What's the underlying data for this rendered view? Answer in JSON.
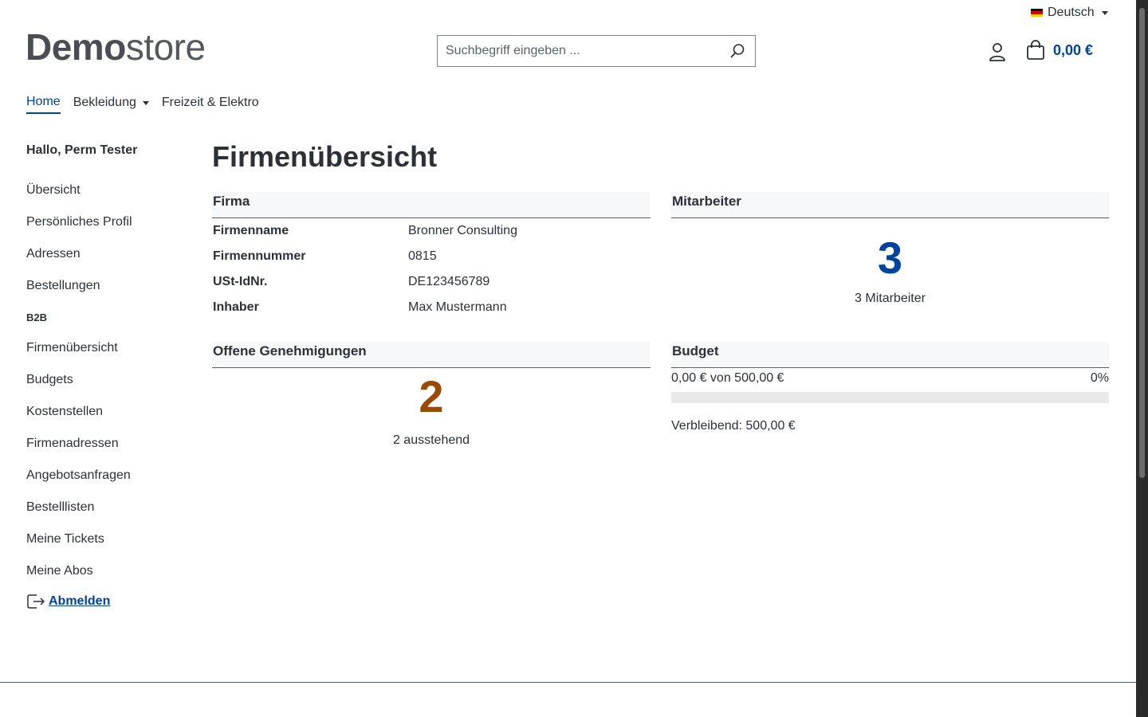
{
  "header": {
    "language": "Deutsch",
    "logo_bold": "Demo",
    "logo_light": "store",
    "search_placeholder": "Suchbegriff eingeben ...",
    "cart_total": "0,00 €"
  },
  "nav": {
    "items": [
      {
        "label": "Home",
        "active": true
      },
      {
        "label": "Bekleidung",
        "dropdown": true
      },
      {
        "label": "Freizeit & Elektro"
      }
    ]
  },
  "sidebar": {
    "greeting": "Hallo, Perm Tester",
    "items_top": [
      "Übersicht",
      "Persönliches Profil",
      "Adressen",
      "Bestellungen"
    ],
    "b2b_heading": "B2B",
    "items_b2b": [
      "Firmenübersicht",
      "Budgets",
      "Kostenstellen",
      "Firmenadressen",
      "Angebotsanfragen",
      "Bestelllisten",
      "Meine Tickets",
      "Meine Abos"
    ],
    "logout": "Abmelden"
  },
  "main": {
    "title": "Firmenübersicht",
    "firma": {
      "heading": "Firma",
      "rows": [
        {
          "key": "Firmenname",
          "value": "Bronner Consulting"
        },
        {
          "key": "Firmennummer",
          "value": "0815"
        },
        {
          "key": "USt-IdNr.",
          "value": "DE123456789"
        },
        {
          "key": "Inhaber",
          "value": "Max Mustermann"
        }
      ]
    },
    "mitarbeiter": {
      "heading": "Mitarbeiter",
      "count": "3",
      "label": "3 Mitarbeiter"
    },
    "genehmigungen": {
      "heading": "Offene Genehmigungen",
      "count": "2",
      "label": "2 ausstehend"
    },
    "budget": {
      "heading": "Budget",
      "used_text": "0,00 € von 500,00 €",
      "percent_text": "0%",
      "used_fraction": 0,
      "remaining_text": "Verbleibend: 500,00 €"
    }
  },
  "colors": {
    "accent": "#0042a0",
    "warning": "#9a4b00",
    "text": "#2b3136"
  }
}
